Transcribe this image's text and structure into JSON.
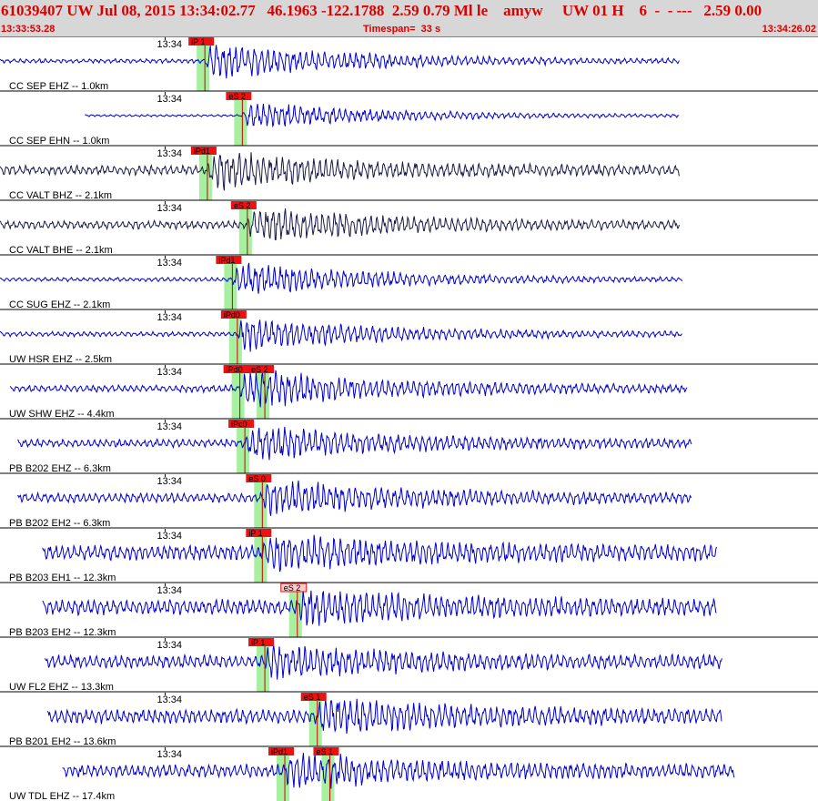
{
  "header": {
    "event_line": "61039407 UW Jul 08, 2015 13:34:02.77   46.1963 -122.1788  2.59 0.79 Ml le    amyw     UW 01 H    6  -  - ---   2.59 0.00",
    "start_time": "13:33:53.28",
    "timespan": "Timespan=  33 s",
    "end_time": "13:34:26.02"
  },
  "colors": {
    "header_bg": "#d7d7d7",
    "header_text": "#d80000",
    "trace_blue": "#0000cc",
    "trace_dark": "#1a1a4a",
    "pick_window": "#a6f0a0",
    "pick_flag": "#ee1111",
    "pick_flag_light": "#ffc8c8",
    "pick_line": "#cc0000"
  },
  "chart_data": {
    "type": "seismogram",
    "time_start": "13:33:53.28",
    "time_end": "13:34:26.02",
    "timespan_s": 33,
    "minute_marker": "13:34",
    "channels": [
      {
        "label": "CC SEP EHZ -- 1.0km",
        "trace_start_s": 0.0,
        "trace_end_s": 27.2,
        "amplitude": 18,
        "color": "blue",
        "background_noise": 0.12,
        "picks": [
          {
            "label": "iP 1",
            "time_s": 8.2,
            "style": "red"
          }
        ]
      },
      {
        "label": "CC SEP EHN -- 1.0km",
        "trace_start_s": 3.4,
        "trace_end_s": 27.2,
        "amplitude": 14,
        "color": "blue",
        "background_noise": 0.08,
        "picks": [
          {
            "label": "eS 2",
            "time_s": 9.7,
            "style": "red"
          }
        ]
      },
      {
        "label": "CC VALT BHZ -- 2.1km",
        "trace_start_s": 0.0,
        "trace_end_s": 27.2,
        "amplitude": 16,
        "color": "dark",
        "background_noise": 0.3,
        "picks": [
          {
            "label": "iPd1",
            "time_s": 8.3,
            "style": "red"
          }
        ]
      },
      {
        "label": "CC VALT BHE -- 2.1km",
        "trace_start_s": 0.0,
        "trace_end_s": 27.2,
        "amplitude": 16,
        "color": "dark",
        "background_noise": 0.25,
        "picks": [
          {
            "label": "eS 2",
            "time_s": 9.9,
            "style": "red"
          }
        ]
      },
      {
        "label": "CC SUG EHZ -- 2.1km",
        "trace_start_s": 0.0,
        "trace_end_s": 27.3,
        "amplitude": 17,
        "color": "blue",
        "background_noise": 0.12,
        "picks": [
          {
            "label": "iPd1",
            "time_s": 9.3,
            "style": "red"
          }
        ]
      },
      {
        "label": "UW HSR EHZ -- 2.5km",
        "trace_start_s": 0.0,
        "trace_end_s": 27.3,
        "amplitude": 16,
        "color": "blue",
        "background_noise": 0.15,
        "picks": [
          {
            "label": "iPd0",
            "time_s": 9.5,
            "style": "red"
          }
        ]
      },
      {
        "label": "UW SHW EHZ -- 4.4km",
        "trace_start_s": 0.4,
        "trace_end_s": 27.5,
        "amplitude": 18,
        "color": "blue",
        "background_noise": 0.2,
        "picks": [
          {
            "label": "iPd0",
            "time_s": 9.6,
            "style": "red"
          },
          {
            "label": "eS 2",
            "time_s": 10.6,
            "style": "red"
          }
        ]
      },
      {
        "label": "PB B202 EHZ -- 6.3km",
        "trace_start_s": 0.7,
        "trace_end_s": 27.7,
        "amplitude": 16,
        "color": "blue",
        "background_noise": 0.25,
        "picks": [
          {
            "label": "iPc0",
            "time_s": 9.8,
            "style": "red"
          }
        ]
      },
      {
        "label": "PB B202 EH2 -- 6.3km",
        "trace_start_s": 0.7,
        "trace_end_s": 27.7,
        "amplitude": 16,
        "color": "blue",
        "background_noise": 0.3,
        "picks": [
          {
            "label": "eS 0",
            "time_s": 10.5,
            "style": "red"
          }
        ]
      },
      {
        "label": "PB B203 EH1 -- 12.3km",
        "trace_start_s": 1.7,
        "trace_end_s": 28.7,
        "amplitude": 14,
        "color": "blue",
        "background_noise": 0.55,
        "picks": [
          {
            "label": "iP 1",
            "time_s": 10.5,
            "style": "red"
          }
        ]
      },
      {
        "label": "PB B203 EH2 -- 12.3km",
        "trace_start_s": 1.7,
        "trace_end_s": 28.7,
        "amplitude": 14,
        "color": "blue",
        "background_noise": 0.55,
        "picks": [
          {
            "label": "eS 2",
            "time_s": 11.9,
            "style": "light"
          }
        ]
      },
      {
        "label": "UW FL2 EHZ -- 13.3km",
        "trace_start_s": 1.8,
        "trace_end_s": 28.9,
        "amplitude": 14,
        "color": "blue",
        "background_noise": 0.45,
        "picks": [
          {
            "label": "iP 1",
            "time_s": 10.6,
            "style": "red"
          }
        ]
      },
      {
        "label": "PB B201 EH2 -- 13.6km",
        "trace_start_s": 1.9,
        "trace_end_s": 28.9,
        "amplitude": 14,
        "color": "blue",
        "background_noise": 0.5,
        "picks": [
          {
            "label": "eS 1",
            "time_s": 12.7,
            "style": "red"
          }
        ]
      },
      {
        "label": "UW TDL EHZ -- 17.4km",
        "trace_start_s": 2.5,
        "trace_end_s": 29.4,
        "amplitude": 14,
        "color": "blue",
        "background_noise": 0.45,
        "picks": [
          {
            "label": "iPd1",
            "time_s": 11.4,
            "style": "red"
          },
          {
            "label": "eS 1",
            "time_s": 13.2,
            "style": "red"
          }
        ]
      }
    ]
  }
}
